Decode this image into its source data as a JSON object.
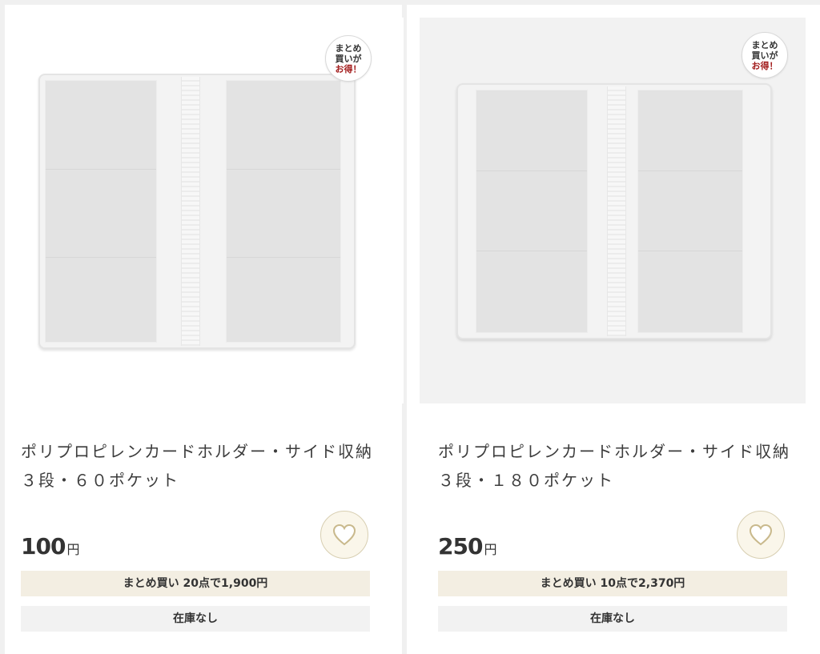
{
  "products": [
    {
      "badge": {
        "line1": "まとめ",
        "line2": "買いが",
        "line3": "お得！"
      },
      "title": "ポリプロピレンカードホルダー・サイド収納　３段・６０ポケット",
      "price": "100",
      "currency": "円",
      "bulk_offer": "まとめ買い 20点で1,900円",
      "stock_status": "在庫なし",
      "favorite_icon": "heart-icon"
    },
    {
      "badge": {
        "line1": "まとめ",
        "line2": "買いが",
        "line3": "お得！"
      },
      "title": "ポリプロピレンカードホルダー・サイド収納　３段・１８０ポケット",
      "price": "250",
      "currency": "円",
      "bulk_offer": "まとめ買い 10点で2,370円",
      "stock_status": "在庫なし",
      "favorite_icon": "heart-icon"
    }
  ],
  "colors": {
    "accent": "#a31d1d",
    "bulk_bg": "#f3eee2",
    "fav_bg": "#faf6ea",
    "fav_border": "#d8cfb2"
  }
}
